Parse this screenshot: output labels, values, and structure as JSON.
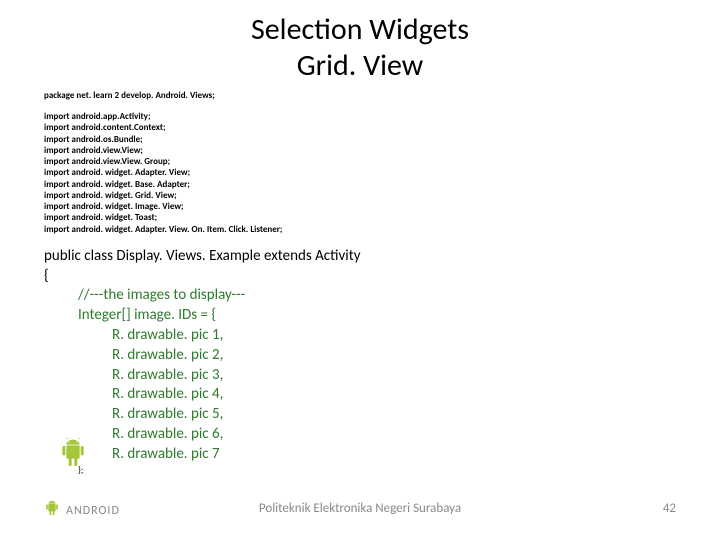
{
  "title_line1": "Selection Widgets",
  "title_line2": "Grid. View",
  "package_line": "package net. learn 2 develop. Android. Views;",
  "imports": [
    "import android.app.Activity;",
    "import android.content.Context;",
    "import android.os.Bundle;",
    "import android.view.View;",
    "import android.view.View. Group;",
    "import android. widget. Adapter. View;",
    "import android. widget. Base. Adapter;",
    "import android. widget. Grid. View;",
    "import android. widget. Image. View;",
    "import android. widget. Toast;",
    "import android. widget. Adapter. View. On. Item. Click. Listener;"
  ],
  "class_head": "public class Display. Views. Example extends Activity",
  "open_brace": "{",
  "comment": "//---the images to display---",
  "array_decl": "Integer[] image. IDs = {",
  "array_items": [
    "R. drawable. pic 1,",
    "R. drawable. pic 2,",
    "R. drawable. pic 3,",
    "R. drawable. pic 4,",
    "R. drawable. pic 5,",
    "R. drawable. pic 6,",
    "R. drawable. pic 7"
  ],
  "array_close": "};",
  "logo_word": "ANDROID",
  "footer_center": "Politeknik Elektronika Negeri Surabaya",
  "page_number": "42",
  "colors": {
    "android_green": "#A4C639"
  }
}
